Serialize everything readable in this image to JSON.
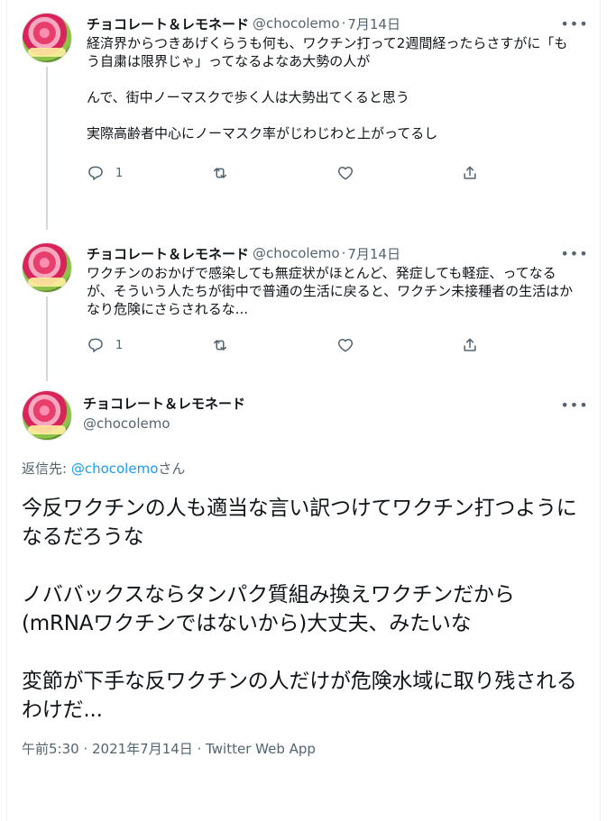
{
  "tweets": [
    {
      "display_name": "チョコレート＆レモネード",
      "handle": "@chocolemo",
      "separator": "·",
      "date": "7月14日",
      "text": "経済界からつきあげくらうも何も、ワクチン打って2週間経ったらさすがに「もう自粛は限界じゃ」ってなるよなあ大勢の人が\n\nんで、街中ノーマスクで歩く人は大勢出てくると思う\n\n実際高齢者中心にノーマスク率がじわじわと上がってるし",
      "reply_count": "1"
    },
    {
      "display_name": "チョコレート＆レモネード",
      "handle": "@chocolemo",
      "separator": "·",
      "date": "7月14日",
      "text": "ワクチンのおかげで感染しても無症状がほとんど、発症しても軽症、ってなるが、そういう人たちが街中で普通の生活に戻ると、ワクチン未接種者の生活はかなり危険にさらされるな...",
      "reply_count": "1"
    }
  ],
  "main_tweet": {
    "display_name": "チョコレート＆レモネード",
    "handle": "@chocolemo",
    "reply_prefix": "返信先: ",
    "reply_mention": "@chocolemo",
    "reply_suffix": "さん",
    "text": "今反ワクチンの人も適当な言い訳つけてワクチン打つようになるだろうな\n\nノババックスならタンパク質組み換えワクチンだから(mRNAワクチンではないから)大丈夫、みたいな\n\n変節が下手な反ワクチンの人だけが危険水域に取り残されるわけだ...",
    "timestamp": "午前5:30 · 2021年7月14日 · ",
    "app": "Twitter Web App"
  },
  "icons": {
    "reply": "reply-icon",
    "retweet": "retweet-icon",
    "like": "heart-icon",
    "share": "share-icon",
    "more": "more-icon"
  },
  "more_glyph": "•••"
}
